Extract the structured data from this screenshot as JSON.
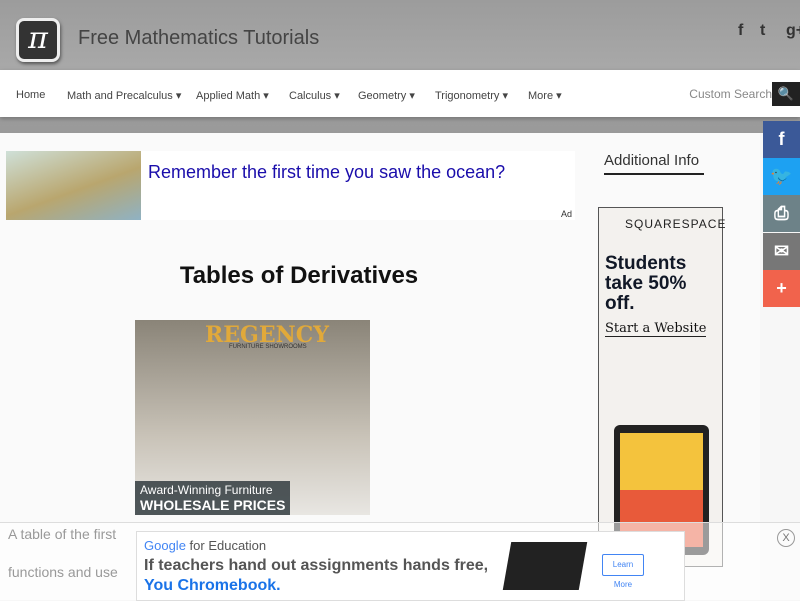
{
  "header": {
    "logo_glyph": "π",
    "title": "Free Mathematics Tutorials",
    "social": [
      "f",
      "t",
      "g+"
    ]
  },
  "nav": {
    "items": [
      "Home",
      "Math and Precalculus ▾",
      "Applied Math ▾",
      "Calculus ▾",
      "Geometry ▾",
      "Trigonometry ▾",
      "More ▾"
    ],
    "search_placeholder": "Custom Search",
    "search_icon": "🔍"
  },
  "ad_top": {
    "headline": "Remember the first time you saw the ocean?",
    "label": "Ad"
  },
  "page_title": "Tables of Derivatives",
  "ad_regency": {
    "brand": "REGENCY",
    "sub": "FURNITURE SHOWROOMS",
    "line1": "Award-Winning Furniture",
    "line2": "WHOLESALE PRICES"
  },
  "sidebar": {
    "heading": "Additional Info",
    "ad": {
      "brand": "SQUARESPACE",
      "headline": "Students take 50% off.",
      "cta": "Start a Website"
    }
  },
  "share": [
    {
      "icon": "f",
      "color": "#3b5998"
    },
    {
      "icon": "🐦",
      "color": "#1da1f2"
    },
    {
      "icon": "⎙",
      "color": "#6d8288"
    },
    {
      "icon": "✉",
      "color": "#777777"
    },
    {
      "icon": "+",
      "color": "#f1634c"
    }
  ],
  "body_text": [
    "A table of the first",
    "functions and use"
  ],
  "ad_bottom": {
    "google": "Google",
    "for_edu": " for Education",
    "line1": "If teachers hand out assignments hands free,",
    "line2": "You Chromebook.",
    "cta": "Learn More",
    "close": "X"
  }
}
